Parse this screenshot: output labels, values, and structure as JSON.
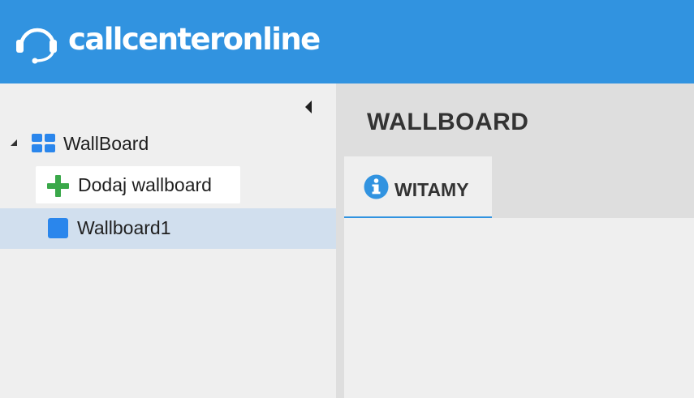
{
  "header": {
    "logo_text": "callcenteronline",
    "logo_icon": "headset-icon",
    "background_color": "#3193e0"
  },
  "sidebar": {
    "tree": {
      "root_label": "WallBoard",
      "root_icon": "grid-icon",
      "expanded": true,
      "add_label": "Dodaj wallboard",
      "items": [
        {
          "label": "Wallboard1",
          "selected": true,
          "icon_color": "#2a86ec"
        }
      ]
    },
    "selected_color": "#d1dfee"
  },
  "main": {
    "title": "WALLBOARD",
    "tabs": [
      {
        "label": "WITAMY",
        "icon": "info-icon",
        "active": true
      }
    ]
  }
}
